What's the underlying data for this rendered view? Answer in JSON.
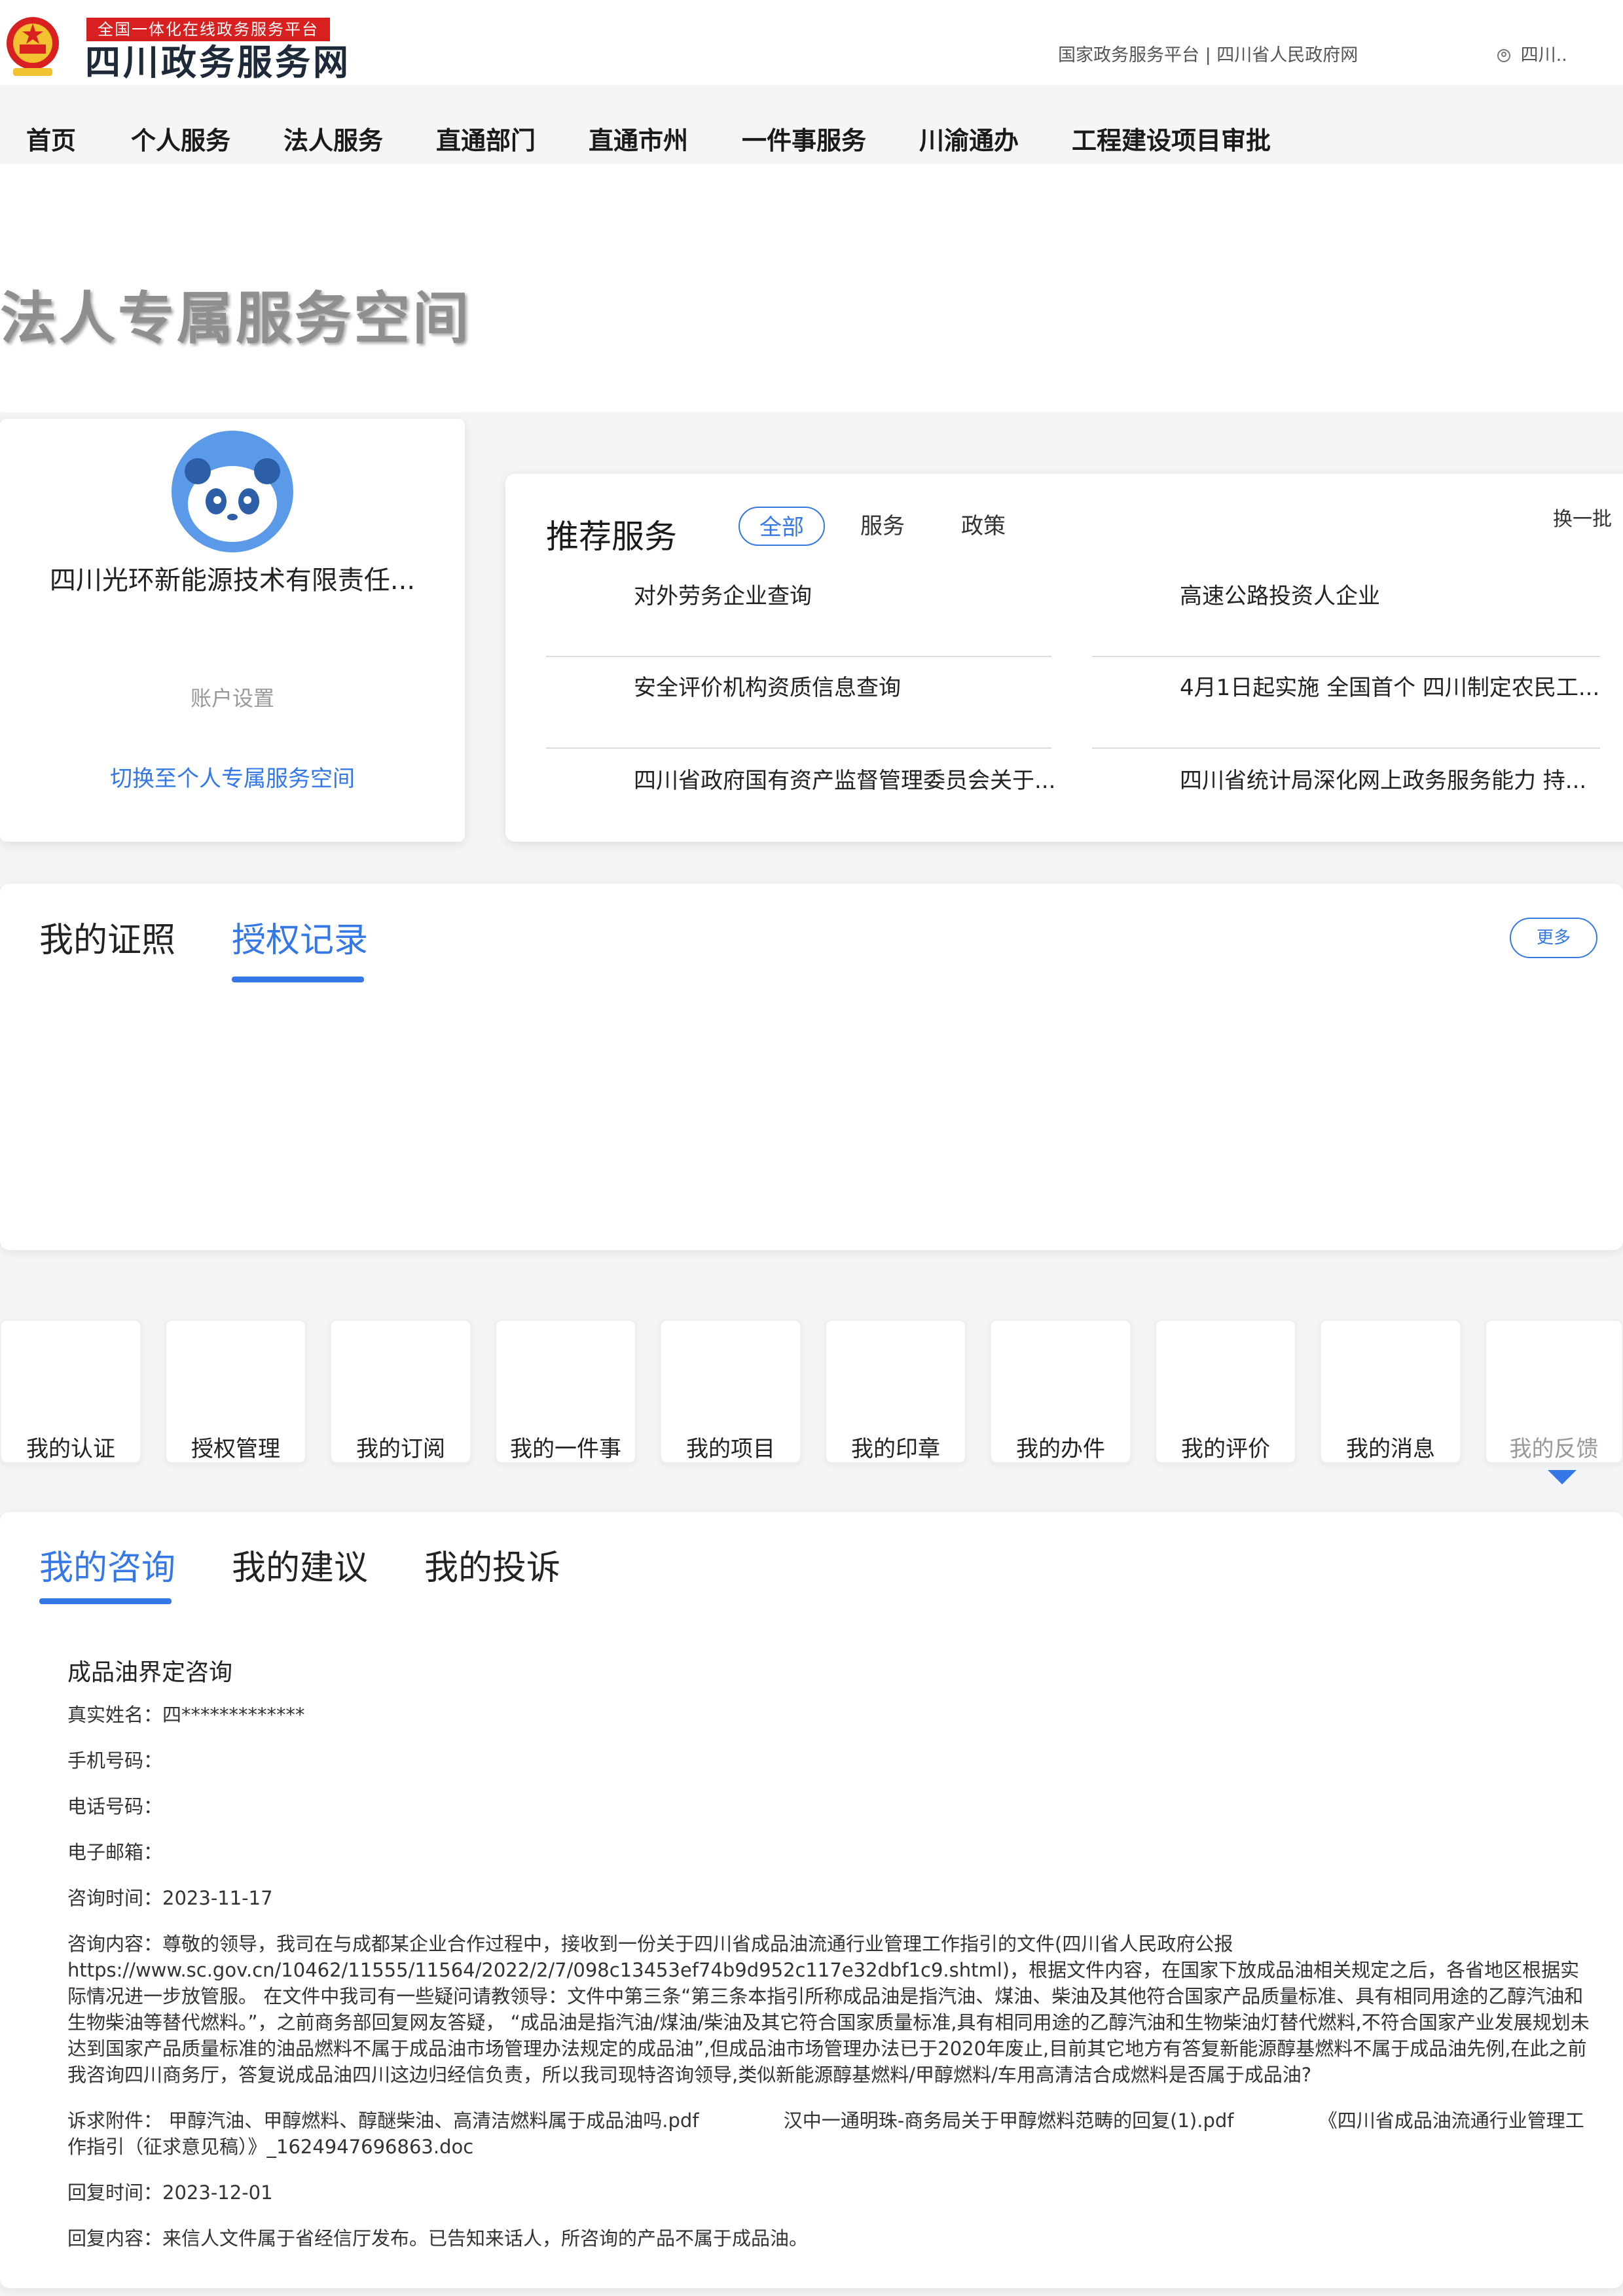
{
  "header": {
    "badge": "全国一体化在线政务服务平台",
    "site_title": "四川政务服务网",
    "top_links": "国家政务服务平台 | 四川省人民政府网",
    "user_label": "四川.."
  },
  "nav": [
    "首页",
    "个人服务",
    "法人服务",
    "直通部门",
    "直通市州",
    "一件事服务",
    "川渝通办",
    "工程建设项目审批"
  ],
  "banner_title": "法人专属服务空间",
  "profile": {
    "company": "四川光环新能源技术有限责任...",
    "account_settings": "账户设置",
    "switch_link": "切换至个人专属服务空间"
  },
  "recommend": {
    "title": "推荐服务",
    "tabs": [
      "全部",
      "服务",
      "政策"
    ],
    "refresh": "换一批",
    "items": [
      "对外劳务企业查询",
      "高速公路投资人企业",
      "安全评价机构资质信息查询",
      "4月1日起实施 全国首个 四川制定农民工...",
      "四川省政府国有资产监督管理委员会关于...",
      "四川省统计局深化网上政务服务能力 持..."
    ]
  },
  "cert": {
    "tabs": [
      "我的证照",
      "授权记录"
    ],
    "more": "更多"
  },
  "tiles": [
    "我的认证",
    "授权管理",
    "我的订阅",
    "我的一件事",
    "我的项目",
    "我的印章",
    "我的办件",
    "我的评价",
    "我的消息",
    "我的反馈"
  ],
  "consult": {
    "tabs": [
      "我的咨询",
      "我的建议",
      "我的投诉"
    ],
    "subject": "成品油界定咨询",
    "name_label": "真实姓名：",
    "name_value": "四*************",
    "phone_label": "手机号码：",
    "tel_label": "电话号码：",
    "email_label": "电子邮箱：",
    "time_label": "咨询时间：",
    "time_value": "2023-11-17",
    "content_label": "咨询内容：",
    "content_value": "尊敬的领导，我司在与成都某企业合作过程中，接收到一份关于四川省成品油流通行业管理工作指引的文件(四川省人民政府公报 https://www.sc.gov.cn/10462/11555/11564/2022/2/7/098c13453ef74b9d952c117e32dbf1c9.shtml)，根据文件内容，在国家下放成品油相关规定之后，各省地区根据实际情况进一步放管服。 在文件中我司有一些疑问请教领导：文件中第三条“第三条本指引所称成品油是指汽油、煤油、柴油及其他符合国家产品质量标准、具有相同用途的乙醇汽油和生物柴油等替代燃料。”，之前商务部回复网友答疑， “成品油是指汽油/煤油/柴油及其它符合国家质量标准,具有相同用途的乙醇汽油和生物柴油灯替代燃料,不符合国家产业发展规划未达到国家产品质量标准的油品燃料不属于成品油市场管理办法规定的成品油”,但成品油市场管理办法已于2020年废止,目前其它地方有答复新能源醇基燃料不属于成品油先例,在此之前我咨询四川商务厅，答复说成品油四川这边归经信负责，所以我司现特咨询领导,类似新能源醇基燃料/甲醇燃料/车用高清洁合成燃料是否属于成品油?",
    "attach_label": "诉求附件：",
    "attachments": [
      "甲醇汽油、甲醇燃料、醇醚柴油、高清洁燃料属于成品油吗.pdf",
      "汉中一通明珠-商务局关于甲醇燃料范畴的回复(1).pdf",
      "《四川省成品油流通行业管理工作指引（征求意见稿）》_1624947696863.doc"
    ],
    "reply_time_label": "回复时间：",
    "reply_time_value": "2023-12-01",
    "reply_label": "回复内容：",
    "reply_value": "来信人文件属于省经信厅发布。已告知来话人，所咨询的产品不属于成品油。"
  },
  "colors": {
    "accent": "#3478e8",
    "brand_red": "#d92020"
  }
}
